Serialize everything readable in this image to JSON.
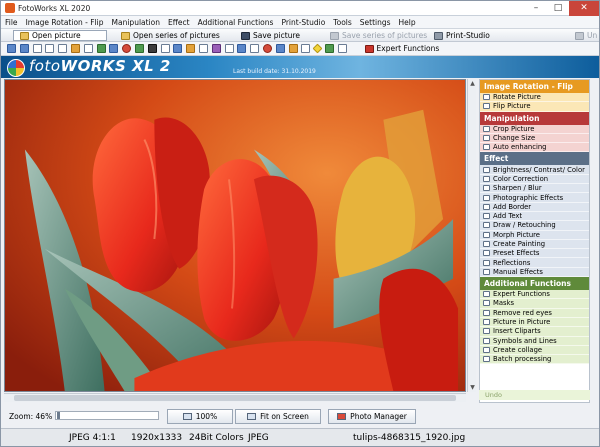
{
  "window": {
    "title": "FotoWorks XL 2020"
  },
  "menu": [
    "File",
    "Image Rotation - Flip",
    "Manipulation",
    "Effect",
    "Additional Functions",
    "Print-Studio",
    "Tools",
    "Settings",
    "Help"
  ],
  "toolbar1": {
    "open_picture": "Open picture",
    "open_series": "Open series of pictures",
    "save_picture": "Save picture",
    "save_series": "Save series of pictures",
    "print_studio": "Print-Studio",
    "undo": "Un"
  },
  "toolbar2": {
    "expert_functions": "Expert Functions"
  },
  "banner": {
    "brand_light": "foto",
    "brand_bold": "WORKS XL",
    "version": "2",
    "build": "Last build date: 31.10.2019"
  },
  "panel": {
    "sections": [
      {
        "title": "Image Rotation - Flip",
        "color": "#e79a21",
        "items": [
          "Rotate Picture",
          "Flip Picture"
        ]
      },
      {
        "title": "Manipulation",
        "color": "#b7393a",
        "items": [
          "Crop Picture",
          "Change Size",
          "Auto enhancing"
        ]
      },
      {
        "title": "Effect",
        "color": "#5b6f87",
        "items": [
          "Brightness/ Contrast/ Color",
          "Color Correction",
          "Sharpen / Blur",
          "Photographic Effects",
          "Add Border",
          "Add Text",
          "Draw / Retouching",
          "Morph Picture",
          "Create Painting",
          "Preset Effects",
          "Reflections",
          "Manual Effects"
        ]
      },
      {
        "title": "Additional Functions",
        "color": "#5f8a3a",
        "items": [
          "Expert Functions",
          "Masks",
          "Remove red eyes",
          "Picture in Picture",
          "Insert Cliparts",
          "Symbols and Lines",
          "Create collage",
          "Batch processing"
        ]
      }
    ],
    "undo_label": "Undo"
  },
  "bottom": {
    "zoom_label": "Zoom: 46%",
    "zoom_value": 0.46,
    "btn_100": "100%",
    "btn_fit": "Fit on Screen",
    "btn_photo_manager": "Photo Manager"
  },
  "status": {
    "format": "JPEG 4:1:1",
    "dimensions": "1920x1333",
    "colors": "24Bit Colors",
    "type": "JPEG",
    "filename": "tulips-4868315_1920.jpg"
  }
}
